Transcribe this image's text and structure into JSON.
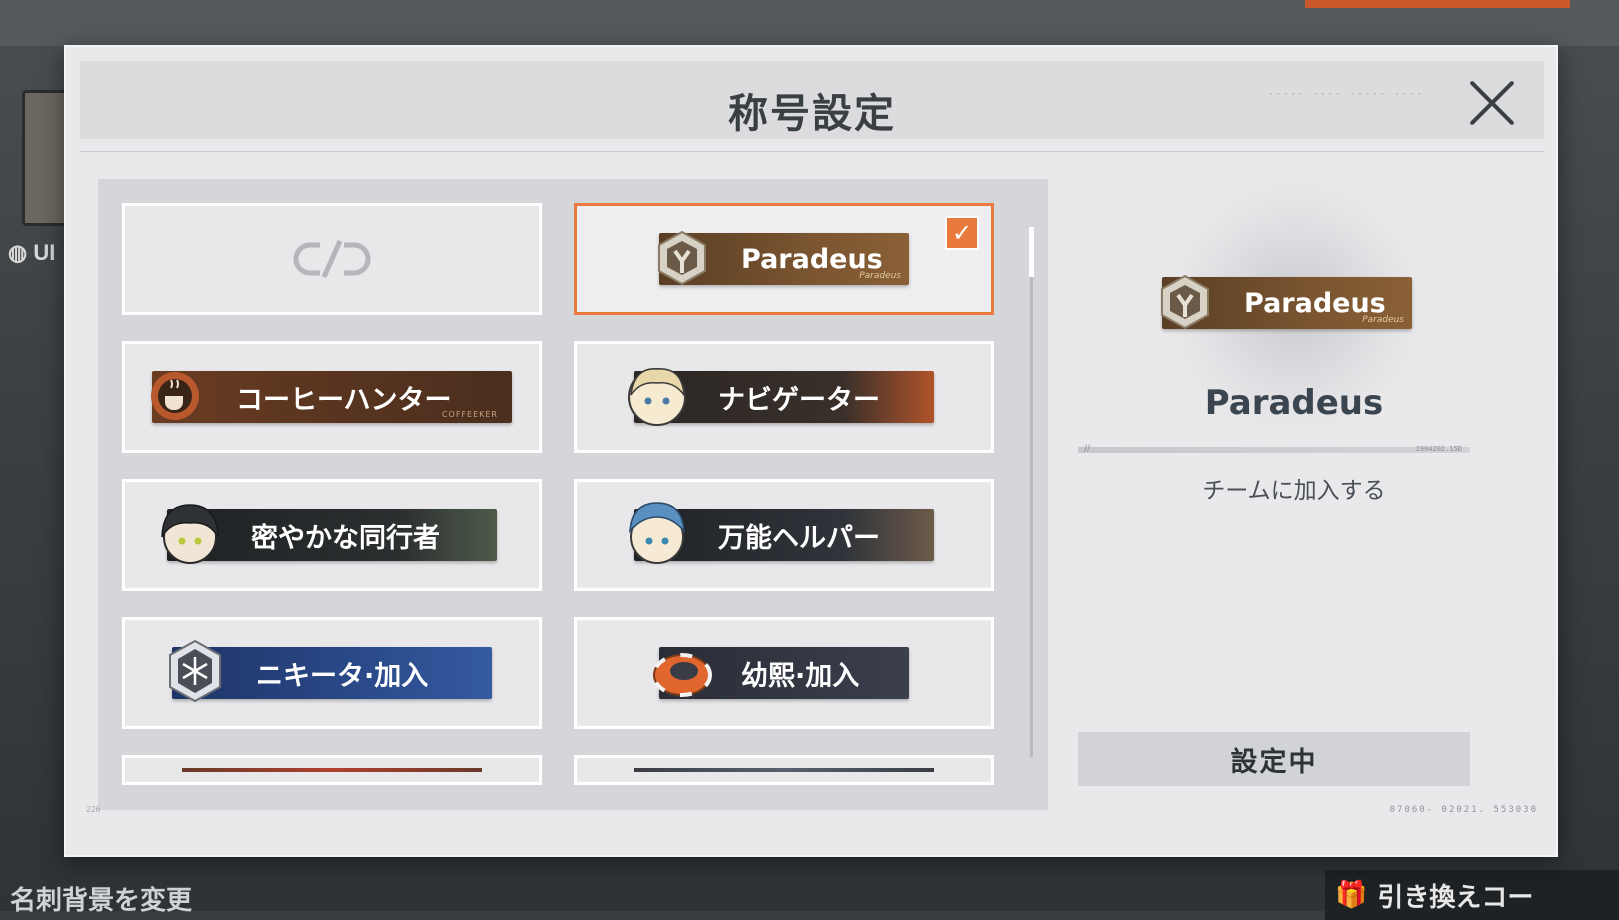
{
  "background": {
    "left_label": "UI",
    "bottom_link": "名刺背景を変更",
    "redeem_button": "引き換えコー"
  },
  "modal": {
    "title": "称号設定",
    "header_code": "----- ----  ----- ----"
  },
  "titles": [
    {
      "id": "none",
      "label": "",
      "icon": "unlink-icon",
      "selected": false
    },
    {
      "id": "paradeus",
      "label": "Paradeus",
      "sub": "Paradeus",
      "icon": "paradeus-emblem-icon",
      "selected": true
    },
    {
      "id": "coffee-hunter",
      "label": "コーヒーハンター",
      "sub": "COFFEEKER",
      "icon": "coffee-cup-icon",
      "selected": false
    },
    {
      "id": "navigator",
      "label": "ナビゲーター",
      "icon": "chibi-blonde-icon",
      "selected": false
    },
    {
      "id": "secret-companion",
      "label": "密やかな同行者",
      "icon": "chibi-dark-hood-icon",
      "selected": false
    },
    {
      "id": "all-round-helper",
      "label": "万能ヘルパー",
      "icon": "chibi-blue-cap-icon",
      "selected": false
    },
    {
      "id": "nikita-join",
      "label": "ニキータ·加入",
      "icon": "snowflake-badge-icon",
      "selected": false
    },
    {
      "id": "youxi-join",
      "label": "幼熙·加入",
      "icon": "ring-badge-icon",
      "selected": false
    }
  ],
  "detail": {
    "name": "Paradeus",
    "banner_label": "Paradeus",
    "banner_sub": "Paradeus",
    "divider_marks": "//",
    "divider_code": "1904202.15D",
    "description": "チームに加入する",
    "status_button": "設定中"
  },
  "footer": {
    "left_code": "226",
    "right_code": "07060- 02021. 553030"
  },
  "colors": {
    "accent": "#e87a3e",
    "panel": "#d5d6d9",
    "text_dark": "#3a3f44"
  }
}
